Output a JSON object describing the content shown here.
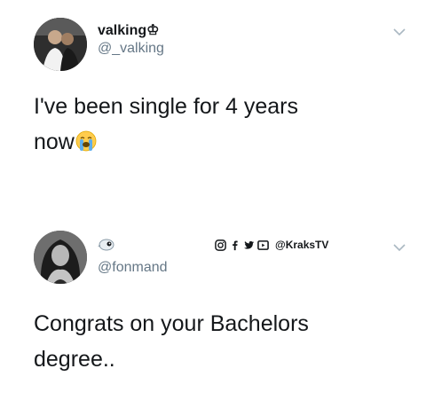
{
  "tweets": [
    {
      "display_name": "valking♔",
      "handle": "@_valking",
      "text_line1": "I've been single for 4 years",
      "text_line2": "now",
      "emoji": "loudly-crying-face",
      "menu_icon": "chevron-down-icon"
    },
    {
      "display_name": "",
      "handle": "@fonmand",
      "badge_icon": "bird-icon",
      "text_line1": "Congrats on your Bachelors",
      "text_line2": "degree..",
      "menu_icon": "chevron-down-icon"
    }
  ],
  "watermark": {
    "icons": [
      "instagram-icon",
      "facebook-icon",
      "twitter-icon",
      "youtube-icon"
    ],
    "text": "@KraksTV"
  },
  "colors": {
    "text": "#14171a",
    "secondary": "#657786",
    "chevron": "#aab8c2"
  }
}
